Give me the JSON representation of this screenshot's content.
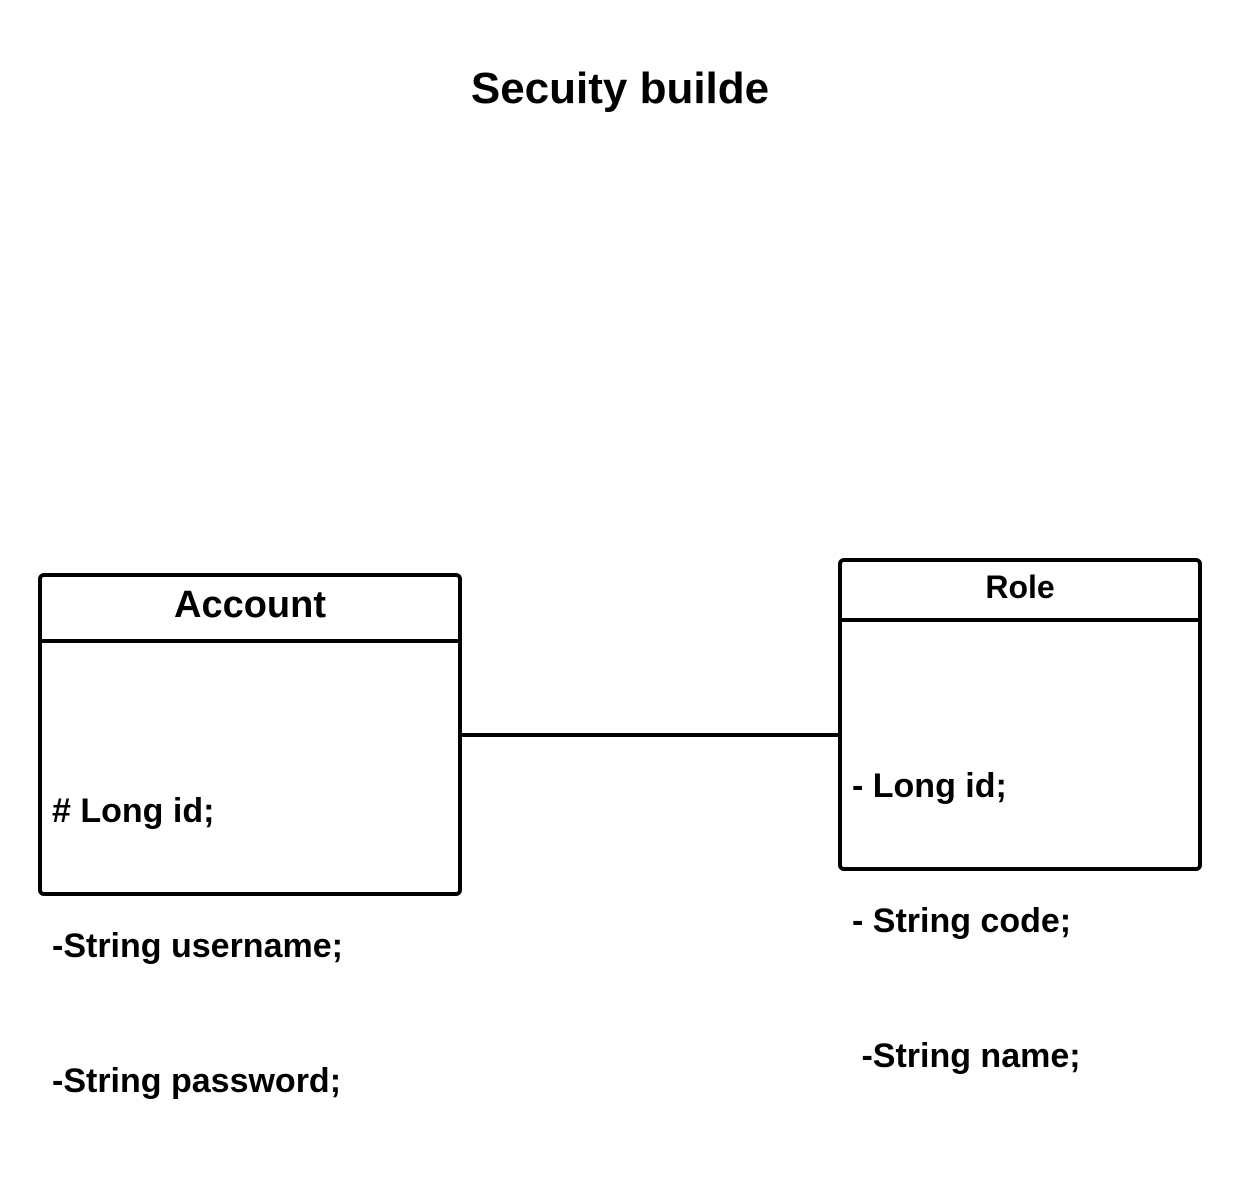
{
  "diagram": {
    "title": "Secuity builde",
    "classes": [
      {
        "name": "Account",
        "attributes": [
          "# Long id;",
          "-String username;",
          "-String password;"
        ]
      },
      {
        "name": "Role",
        "attributes": [
          "- Long id;",
          "- String code;",
          " -String name;"
        ]
      }
    ],
    "associations": [
      {
        "from": "Account",
        "to": "Role"
      }
    ]
  }
}
